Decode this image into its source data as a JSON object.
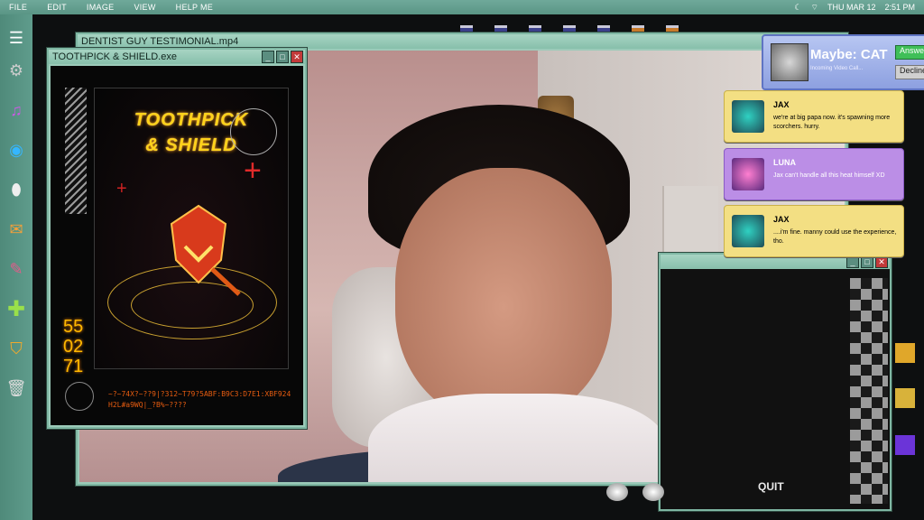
{
  "menubar": {
    "items": [
      "FILE",
      "EDIT",
      "IMAGE",
      "VIEW",
      "HELP ME"
    ],
    "date": "THU MAR 12",
    "time": "2:51 PM"
  },
  "video_window": {
    "title": "DENTIST GUY TESTIMONIAL.mp4"
  },
  "toothpick_window": {
    "title": "TOOTHPICK & SHIELD.exe",
    "poster_title_line1": "TOOTHPICK",
    "poster_title_line2": "& SHIELD",
    "numbers": [
      "55",
      "02",
      "71"
    ],
    "code_line1": "~?~74X?~??9|?312~T79?5ABF:B9C3:D7E1:XBF924",
    "code_line2": "H2L#a9WQ|_?B%~????"
  },
  "chess_window": {
    "quit_label": "QUIT"
  },
  "call": {
    "caller": "Maybe: CAT",
    "subtitle": "Incoming Video Call...",
    "answer_label": "Answer",
    "decline_label": "Decline"
  },
  "messages": [
    {
      "name": "JAX",
      "text": "we're at big papa now. it's spawning more scorchers. hurry."
    },
    {
      "name": "LUNA",
      "text": "Jax can't handle all this heat himself XD"
    },
    {
      "name": "JAX",
      "text": "....i'm fine. manny could use the experience, tho."
    }
  ],
  "colors": {
    "menubar": "#5f9c8c",
    "window_frame": "#9ccab9",
    "yellow_msg": "#f3df83",
    "purple_msg": "#bb8ee6",
    "call_bg": "#9fb0e8"
  }
}
